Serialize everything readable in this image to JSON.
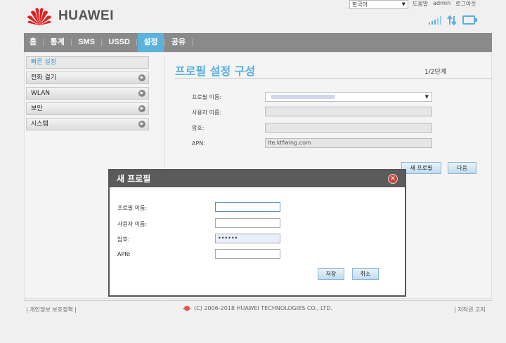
{
  "header": {
    "brand": "HUAWEI",
    "language": "한국어",
    "links": [
      "도움말",
      "admin",
      "로그아웃"
    ]
  },
  "nav": {
    "items": [
      {
        "label": "홈",
        "active": false
      },
      {
        "label": "통계",
        "active": false
      },
      {
        "label": "SMS",
        "active": false
      },
      {
        "label": "USSD",
        "active": false
      },
      {
        "label": "설정",
        "active": true
      },
      {
        "label": "공유",
        "active": false
      }
    ]
  },
  "sidebar": {
    "items": [
      {
        "label": "빠른 설정",
        "active": true,
        "arrow": false
      },
      {
        "label": "전화 걸기",
        "active": false,
        "arrow": true
      },
      {
        "label": "WLAN",
        "active": false,
        "arrow": true
      },
      {
        "label": "보안",
        "active": false,
        "arrow": true
      },
      {
        "label": "시스템",
        "active": false,
        "arrow": true
      }
    ]
  },
  "main": {
    "title": "프로필 설정 구성",
    "step": "1/2단계",
    "fields": {
      "profile_label": "프로필 이름:",
      "profile_value": "",
      "username_label": "사용자 이름:",
      "password_label": "암호:",
      "apn_label": "APN:",
      "apn_value": "lte.ktfwing.com"
    },
    "new_profile_button": "새 프로필",
    "next_button": "다음"
  },
  "modal": {
    "title": "새 프로필",
    "profile_label": "프로필 이름:",
    "username_label": "사용자 이름:",
    "password_label": "암호:",
    "password_value": "••••••",
    "apn_label": "APN:",
    "save_button": "저장",
    "cancel_button": "취소"
  },
  "footer": {
    "privacy": "개인정보 보호정책",
    "copyright": "(C) 2006-2018 HUAWEI TECHNOLOGIES CO., LTD.",
    "copyright_notice": "저작권 고지"
  },
  "colors": {
    "accent": "#5bb2dc",
    "nav_bg": "#8a8a8a",
    "brand_red": "#e02020",
    "modal_header": "#5b5b5b"
  }
}
